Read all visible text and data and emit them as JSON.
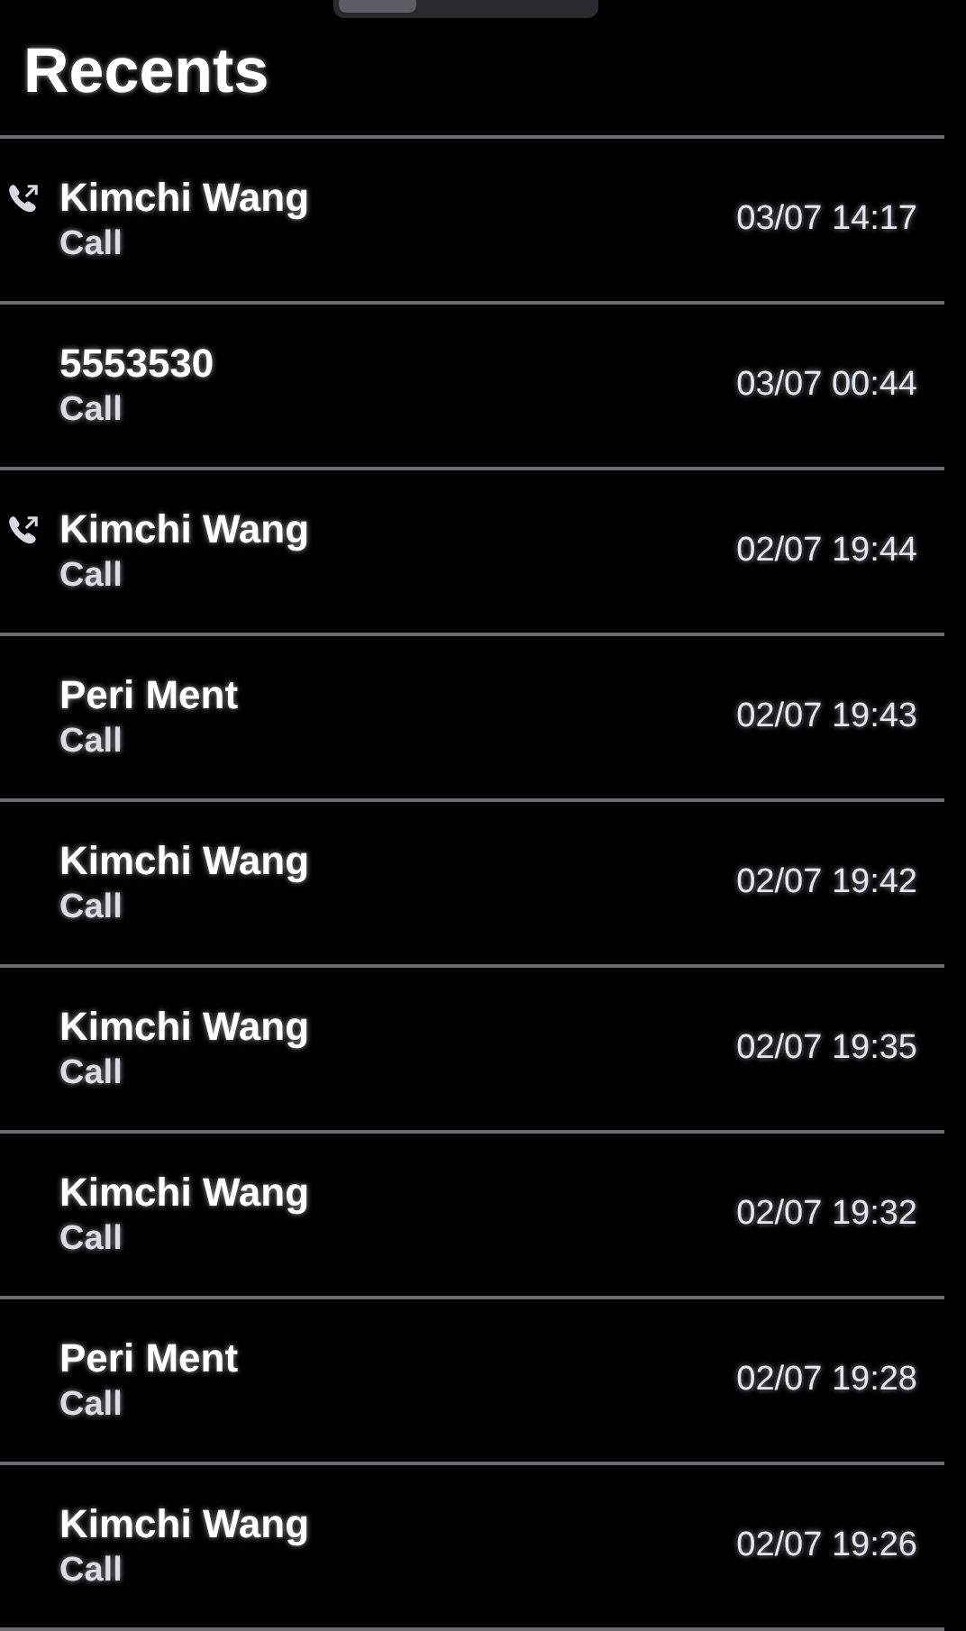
{
  "title": "Recents",
  "calls": [
    {
      "name": "Kimchi Wang",
      "type": "Call",
      "time": "03/07 14:17",
      "outgoing": true
    },
    {
      "name": "5553530",
      "type": "Call",
      "time": "03/07 00:44",
      "outgoing": false
    },
    {
      "name": "Kimchi Wang",
      "type": "Call",
      "time": "02/07 19:44",
      "outgoing": true
    },
    {
      "name": "Peri Ment",
      "type": "Call",
      "time": "02/07 19:43",
      "outgoing": false
    },
    {
      "name": "Kimchi Wang",
      "type": "Call",
      "time": "02/07 19:42",
      "outgoing": false
    },
    {
      "name": "Kimchi Wang",
      "type": "Call",
      "time": "02/07 19:35",
      "outgoing": false
    },
    {
      "name": "Kimchi Wang",
      "type": "Call",
      "time": "02/07 19:32",
      "outgoing": false
    },
    {
      "name": "Peri Ment",
      "type": "Call",
      "time": "02/07 19:28",
      "outgoing": false
    },
    {
      "name": "Kimchi Wang",
      "type": "Call",
      "time": "02/07 19:26",
      "outgoing": false
    }
  ]
}
